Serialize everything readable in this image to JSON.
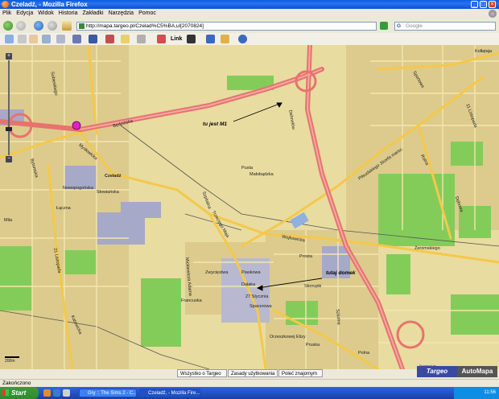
{
  "window": {
    "title": "Czeladź, - Mozilla Firefox"
  },
  "menu": [
    "Plik",
    "Edycja",
    "Widok",
    "Historia",
    "Zakładki",
    "Narzędzia",
    "Pomoc"
  ],
  "nav": {
    "url": "http://mapa.targeo.pl/Czelad%C5%BA,ul[2070824]",
    "search_placeholder": "Google"
  },
  "toolbar": {
    "link_label": "Link"
  },
  "map": {
    "scale_label": "200m",
    "annotations": {
      "m1": "tu jest M1",
      "home": "tutaj domek"
    },
    "streets": [
      "Będzińska",
      "Czeladź",
      "Nowopogońska",
      "Słowiańska",
      "Szpitalna",
      "Mysłowicka",
      "Trzeciego Maja",
      "Pusta",
      "Małobądzka",
      "Dehnelów",
      "Trzeciego Maja",
      "Wojkowicka",
      "Piłsudskiego Józefa marsz.",
      "Sportowa",
      "11 Listopada",
      "Kołłątaja",
      "Dębowa",
      "Prosta",
      "Skorupki",
      "Dalaka",
      "Piaskowa",
      "Zwycięstwa",
      "27 Stycznia",
      "Spacerowa",
      "Francuska",
      "Źeromskiego",
      "Orzeszkowej Elizy",
      "Pruska",
      "Mila",
      "Łączna",
      "21 Listopada",
      "Katowicka",
      "Mickiewicza Adama",
      "Polna",
      "Szkolna",
      "Rolna",
      "Bytomska",
      "Sobieskiego"
    ]
  },
  "bottom_links": [
    "Wszystko o Targeo",
    "Zasady użytkowania",
    "Poleć znajomym"
  ],
  "brand": {
    "powered": "Powered by",
    "targeo": "Targeo",
    "automapa": "AutoMapa"
  },
  "status": {
    "text": "Zakończono"
  },
  "taskbar": {
    "start": "Start",
    "tasks": [
      "Gry :: The Sims 2 - C...",
      "Czeladź, - Mozilla Fire..."
    ],
    "clock": "11:56"
  },
  "colors": {
    "motorway": "#e8726e",
    "main_road": "#f5c84a",
    "urban": "#d8c788",
    "green": "#84cc5a",
    "industrial": "#a7a9c8",
    "base": "#e8dca0",
    "marker": "#e020c8"
  },
  "icons": [
    "back-arrow-icon",
    "forward-arrow-icon",
    "reload-icon",
    "stop-icon",
    "home-icon",
    "go-arrow-icon",
    "google-search-icon",
    "hand-pan-icon",
    "zoom-in-icon",
    "print-icon",
    "location-pin-icon",
    "help-icon"
  ]
}
